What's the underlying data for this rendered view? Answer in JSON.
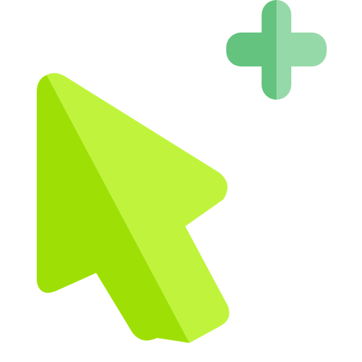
{
  "icons": {
    "cursor": "cursor-arrow-icon",
    "plus": "plus-icon"
  },
  "colors": {
    "background": "#ffffff",
    "cursor_light": "#c0f43c",
    "cursor_dark": "#9ee005",
    "plus_dark": "#64c37f",
    "plus_light": "#96d9a8"
  }
}
